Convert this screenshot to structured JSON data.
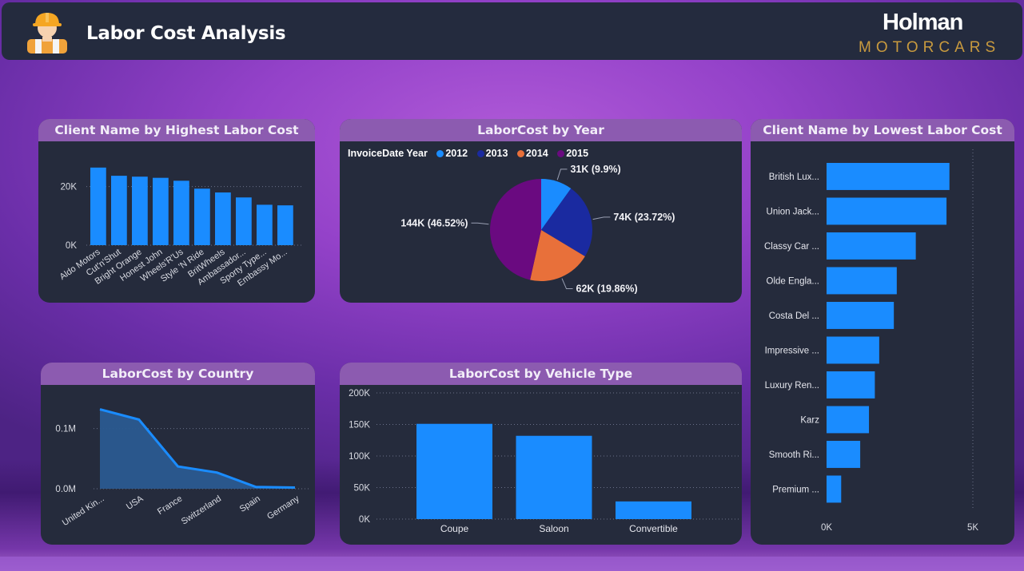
{
  "header": {
    "title": "Labor Cost Analysis",
    "brand_name": "Holman",
    "brand_sub": "MOTORCARS"
  },
  "colors": {
    "bar": "#1a8cff",
    "year_2012": "#1a8cff",
    "year_2013": "#1a2aa0",
    "year_2014": "#e8703a",
    "year_2015": "#6a0a80",
    "card_bg": "#252b3c",
    "card_title_bg": "#8c5bb0"
  },
  "charts": {
    "highest": {
      "title": "Client Name by Highest Labor Cost",
      "ticks": [
        "20K",
        "0K"
      ]
    },
    "year": {
      "title": "LaborCost by Year",
      "legend_title": "InvoiceDate Year"
    },
    "lowest": {
      "title": "Client Name by Lowest Labor Cost",
      "ticks": [
        "0K",
        "5K"
      ]
    },
    "country": {
      "title": "LaborCost by Country",
      "ticks": [
        "0.1M",
        "0.0M"
      ]
    },
    "vehicle": {
      "title": "LaborCost by Vehicle Type",
      "ticks": [
        "200K",
        "150K",
        "100K",
        "50K",
        "0K"
      ]
    }
  },
  "chart_data": [
    {
      "id": "highest",
      "type": "bar",
      "title": "Client Name by Highest Labor Cost",
      "categories": [
        "Aldo Motors",
        "Cut'n'Shut",
        "Bright Orange",
        "Honest John",
        "Wheels'R'Us",
        "Style 'N Ride",
        "BritWheels",
        "Ambassador...",
        "Sporty Type...",
        "Embassy Mo..."
      ],
      "values": [
        26500,
        23700,
        23400,
        23000,
        22000,
        19300,
        18000,
        16300,
        13800,
        13600
      ],
      "ylim": [
        0,
        30000
      ]
    },
    {
      "id": "year",
      "type": "pie",
      "title": "LaborCost by Year",
      "legend_title": "InvoiceDate Year",
      "labels": [
        "2012",
        "2013",
        "2014",
        "2015"
      ],
      "values": [
        9.9,
        23.72,
        19.86,
        46.52
      ],
      "data_labels": [
        "31K (9.9%)",
        "74K (23.72%)",
        "62K (19.86%)",
        "144K (46.52%)"
      ]
    },
    {
      "id": "lowest",
      "type": "bar",
      "orientation": "horizontal",
      "title": "Client Name by Lowest Labor Cost",
      "categories": [
        "British Lux...",
        "Union Jack...",
        "Classy Car ...",
        "Olde Engla...",
        "Costa Del ...",
        "Impressive ...",
        "Luxury Ren...",
        "Karz",
        "Smooth Ri...",
        "Premium ..."
      ],
      "values": [
        4200,
        4100,
        3050,
        2400,
        2300,
        1800,
        1650,
        1450,
        1150,
        500
      ],
      "xlim": [
        0,
        5000
      ]
    },
    {
      "id": "country",
      "type": "area",
      "title": "LaborCost by Country",
      "categories": [
        "United Kin...",
        "USA",
        "France",
        "Switzerland",
        "Spain",
        "Germany"
      ],
      "values": [
        132000,
        115000,
        37000,
        27000,
        3000,
        2000
      ],
      "ylim": [
        0,
        150000
      ]
    },
    {
      "id": "vehicle",
      "type": "bar",
      "title": "LaborCost by Vehicle Type",
      "categories": [
        "Coupe",
        "Saloon",
        "Convertible"
      ],
      "values": [
        151000,
        132000,
        28000
      ],
      "ylim": [
        0,
        200000
      ]
    }
  ]
}
